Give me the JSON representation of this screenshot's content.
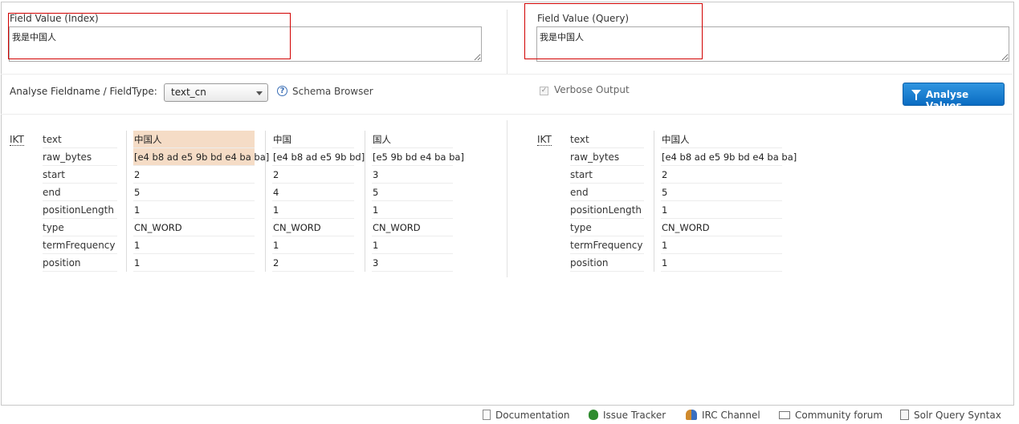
{
  "index_field": {
    "label": "Field Value (Index)",
    "value": "我是中国人"
  },
  "query_field": {
    "label": "Field Value (Query)",
    "value": "我是中国人"
  },
  "fieldtype": {
    "label": "Analyse Fieldname / FieldType:",
    "selected": "text_cn"
  },
  "schema_browser": {
    "icon": "help-icon",
    "label": "Schema Browser"
  },
  "verbose": {
    "label": "Verbose Output",
    "checked": true
  },
  "analyse_button": {
    "label": "Analyse Values",
    "icon": "funnel-icon"
  },
  "index_analysis": {
    "analyzer": "IKT",
    "properties": [
      "text",
      "raw_bytes",
      "start",
      "end",
      "positionLength",
      "type",
      "termFrequency",
      "position"
    ],
    "tokens": [
      {
        "values": [
          "中国人",
          "[e4 b8 ad e5 9b bd e4 ba ba]",
          "2",
          "5",
          "1",
          "CN_WORD",
          "1",
          "1"
        ],
        "highlight": true
      },
      {
        "values": [
          "中国",
          "[e4 b8 ad e5 9b bd]",
          "2",
          "4",
          "1",
          "CN_WORD",
          "1",
          "2"
        ],
        "highlight": false
      },
      {
        "values": [
          "国人",
          "[e5 9b bd e4 ba ba]",
          "3",
          "5",
          "1",
          "CN_WORD",
          "1",
          "3"
        ],
        "highlight": false
      }
    ]
  },
  "query_analysis": {
    "analyzer": "IKT",
    "properties": [
      "text",
      "raw_bytes",
      "start",
      "end",
      "positionLength",
      "type",
      "termFrequency",
      "position"
    ],
    "tokens": [
      {
        "values": [
          "中国人",
          "[e4 b8 ad e5 9b bd e4 ba ba]",
          "2",
          "5",
          "1",
          "CN_WORD",
          "1",
          "1"
        ],
        "highlight": false
      }
    ]
  },
  "footer": [
    {
      "label": "Documentation",
      "icon": "document-icon"
    },
    {
      "label": "Issue Tracker",
      "icon": "bug-icon"
    },
    {
      "label": "IRC Channel",
      "icon": "irc-icon"
    },
    {
      "label": "Community forum",
      "icon": "mail-icon"
    },
    {
      "label": "Solr Query Syntax",
      "icon": "solr-icon"
    }
  ],
  "colors": {
    "highlight": "#f5dcc6",
    "button": "#1a7fd4",
    "annotation_box": "#d10000"
  }
}
